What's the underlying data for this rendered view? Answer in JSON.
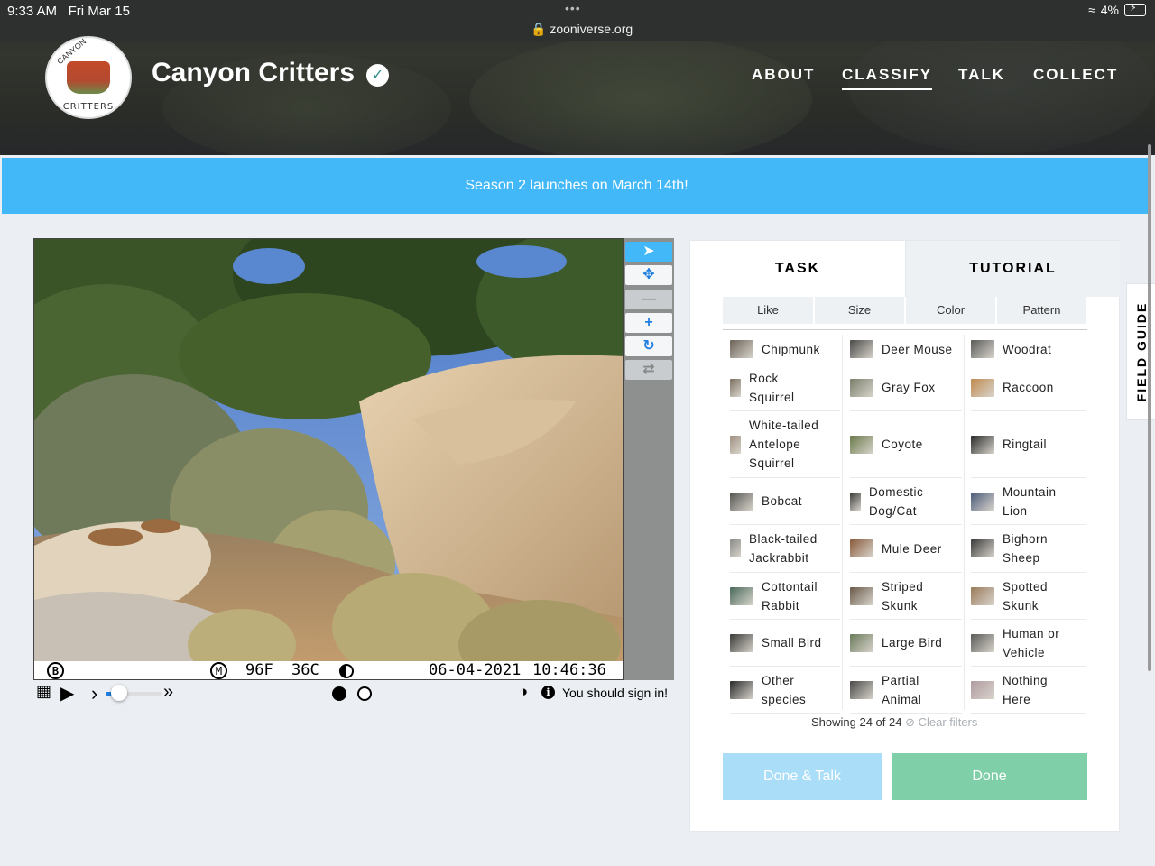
{
  "statusbar": {
    "time": "9:33 AM",
    "date": "Fri Mar 15",
    "dots": "•••",
    "url": "zooniverse.org",
    "battery": "4%"
  },
  "header": {
    "logo_text_top": "CANYON",
    "logo_text_bottom": "CRITTERS",
    "title": "Canyon Critters",
    "verified_glyph": "✓",
    "nav": {
      "about": "ABOUT",
      "classify": "CLASSIFY",
      "talk": "TALK",
      "collect": "COLLECT"
    }
  },
  "banner": {
    "text": "Season 2 launches on March 14th!"
  },
  "viewer": {
    "overlay": {
      "camera_badge": "B",
      "mode_badge": "M",
      "temp_f": "96F",
      "temp_c": "36C",
      "date": "06-04-2021",
      "time": "10:46:36"
    },
    "tools": {
      "pointer": "pointer-icon",
      "pan": "move-icon",
      "zoom_out": "minus-icon",
      "zoom_in": "plus-icon",
      "rotate": "rotate-icon",
      "reset": "refresh-icon"
    },
    "controls": {
      "grid_icon": "▦",
      "play_icon": "▶",
      "step_icon": "›",
      "skip_icon": "»",
      "contrast_icon": "◑",
      "info_icon": "i",
      "message": "You should sign in!"
    },
    "frames": {
      "count": 2,
      "current": 1
    },
    "playback_speed": 0.25
  },
  "task_panel": {
    "tabs": {
      "task": "TASK",
      "tutorial": "TUTORIAL"
    },
    "filters": [
      "Like",
      "Size",
      "Color",
      "Pattern"
    ],
    "choices": [
      {
        "label": "Chipmunk",
        "color": "#6b6257"
      },
      {
        "label": "Deer Mouse",
        "color": "#4a4a48"
      },
      {
        "label": "Woodrat",
        "color": "#5a5a58"
      },
      {
        "label": "Rock\nSquirrel",
        "color": "#7a7060"
      },
      {
        "label": "Gray Fox",
        "color": "#7a7e6a"
      },
      {
        "label": "Raccoon",
        "color": "#c08a50"
      },
      {
        "label": "White-tailed\nAntelope\nSquirrel",
        "color": "#a09080"
      },
      {
        "label": "Coyote",
        "color": "#6a7a4a"
      },
      {
        "label": "Ringtail",
        "color": "#2a2a2a"
      },
      {
        "label": "Bobcat",
        "color": "#555550"
      },
      {
        "label": "Domestic\nDog/Cat",
        "color": "#3a3a38"
      },
      {
        "label": "Mountain\nLion",
        "color": "#4a5a7a"
      },
      {
        "label": "Black-tailed\nJackrabbit",
        "color": "#8a8a88"
      },
      {
        "label": "Mule Deer",
        "color": "#8a5a3a"
      },
      {
        "label": "Bighorn\nSheep",
        "color": "#3a3a3a"
      },
      {
        "label": "Cottontail\nRabbit",
        "color": "#4a6a5a"
      },
      {
        "label": "Striped\nSkunk",
        "color": "#6a5a4a"
      },
      {
        "label": "Spotted\nSkunk",
        "color": "#9a7a5a"
      },
      {
        "label": "Small Bird",
        "color": "#3a3a38"
      },
      {
        "label": "Large Bird",
        "color": "#6a7a5a"
      },
      {
        "label": "Human or\nVehicle",
        "color": "#5a5a58"
      },
      {
        "label": "Other\nspecies",
        "color": "#2a2a2a"
      },
      {
        "label": "Partial\nAnimal",
        "color": "#4a4a48"
      },
      {
        "label": "Nothing\nHere",
        "color": "#b09aa0"
      }
    ],
    "showing": "Showing 24 of 24",
    "clear_filters": "Clear filters",
    "clear_icon": "⊘",
    "buttons": {
      "done_talk": "Done & Talk",
      "done": "Done"
    }
  },
  "field_guide": {
    "label": "FIELD GUIDE"
  },
  "colors": {
    "banner": "#43b8f8",
    "done": "#7fcfa8",
    "done_talk": "#a9ddf8",
    "accent": "#1f7fe0"
  }
}
